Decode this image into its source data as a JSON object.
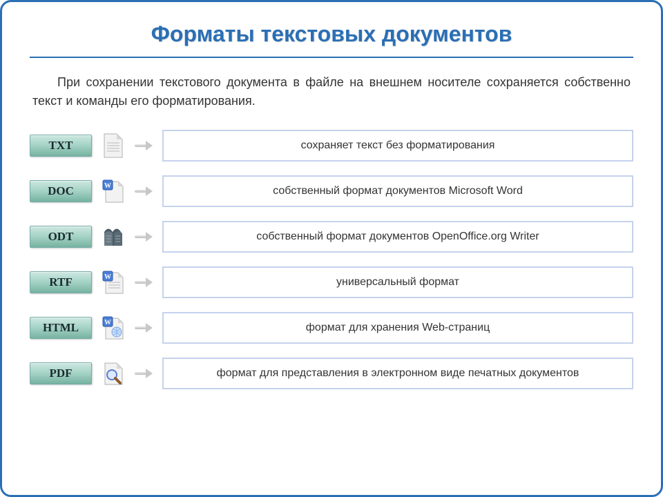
{
  "title": "Форматы текстовых документов",
  "intro": "При сохранении текстового документа в файле на внешнем носителе сохраняется собственно текст и команды его форматирования.",
  "formats": [
    {
      "badge": "TXT",
      "icon": "plain-doc-icon",
      "desc": "сохраняет текст без форматирования"
    },
    {
      "badge": "DOC",
      "icon": "word-doc-icon",
      "desc": "собственный формат документов Microsoft Word"
    },
    {
      "badge": "ODT",
      "icon": "openoffice-icon",
      "desc": "собственный формат документов OpenOffice.org Writer"
    },
    {
      "badge": "RTF",
      "icon": "word-rtf-icon",
      "desc": "универсальный формат"
    },
    {
      "badge": "HTML",
      "icon": "word-html-icon",
      "desc": "формат для хранения Web-страниц"
    },
    {
      "badge": "PDF",
      "icon": "magnifier-icon",
      "desc": "формат для представления в электронном виде печатных документов"
    }
  ]
}
